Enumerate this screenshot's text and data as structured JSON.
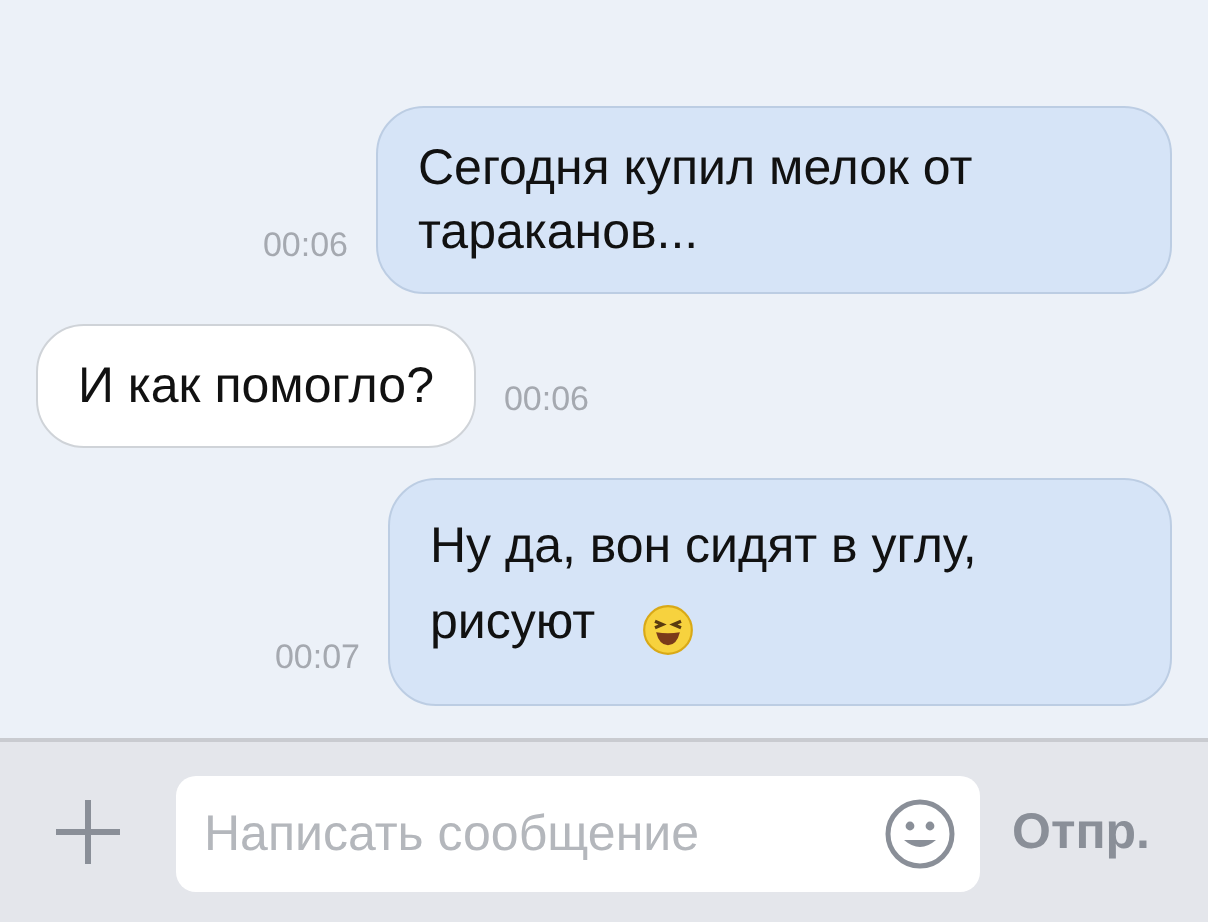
{
  "messages": [
    {
      "kind": "outgoing",
      "text": "Сегодня купил мелок от тараканов...",
      "time": "00:06"
    },
    {
      "kind": "incoming",
      "text": "И как помогло?",
      "time": "00:06"
    },
    {
      "kind": "outgoing",
      "text": "Ну да, вон сидят в углу, рисуют",
      "time": "00:07",
      "emoji": true
    }
  ],
  "composer": {
    "placeholder": "Написать сообщение",
    "send_label": "Отпр."
  }
}
